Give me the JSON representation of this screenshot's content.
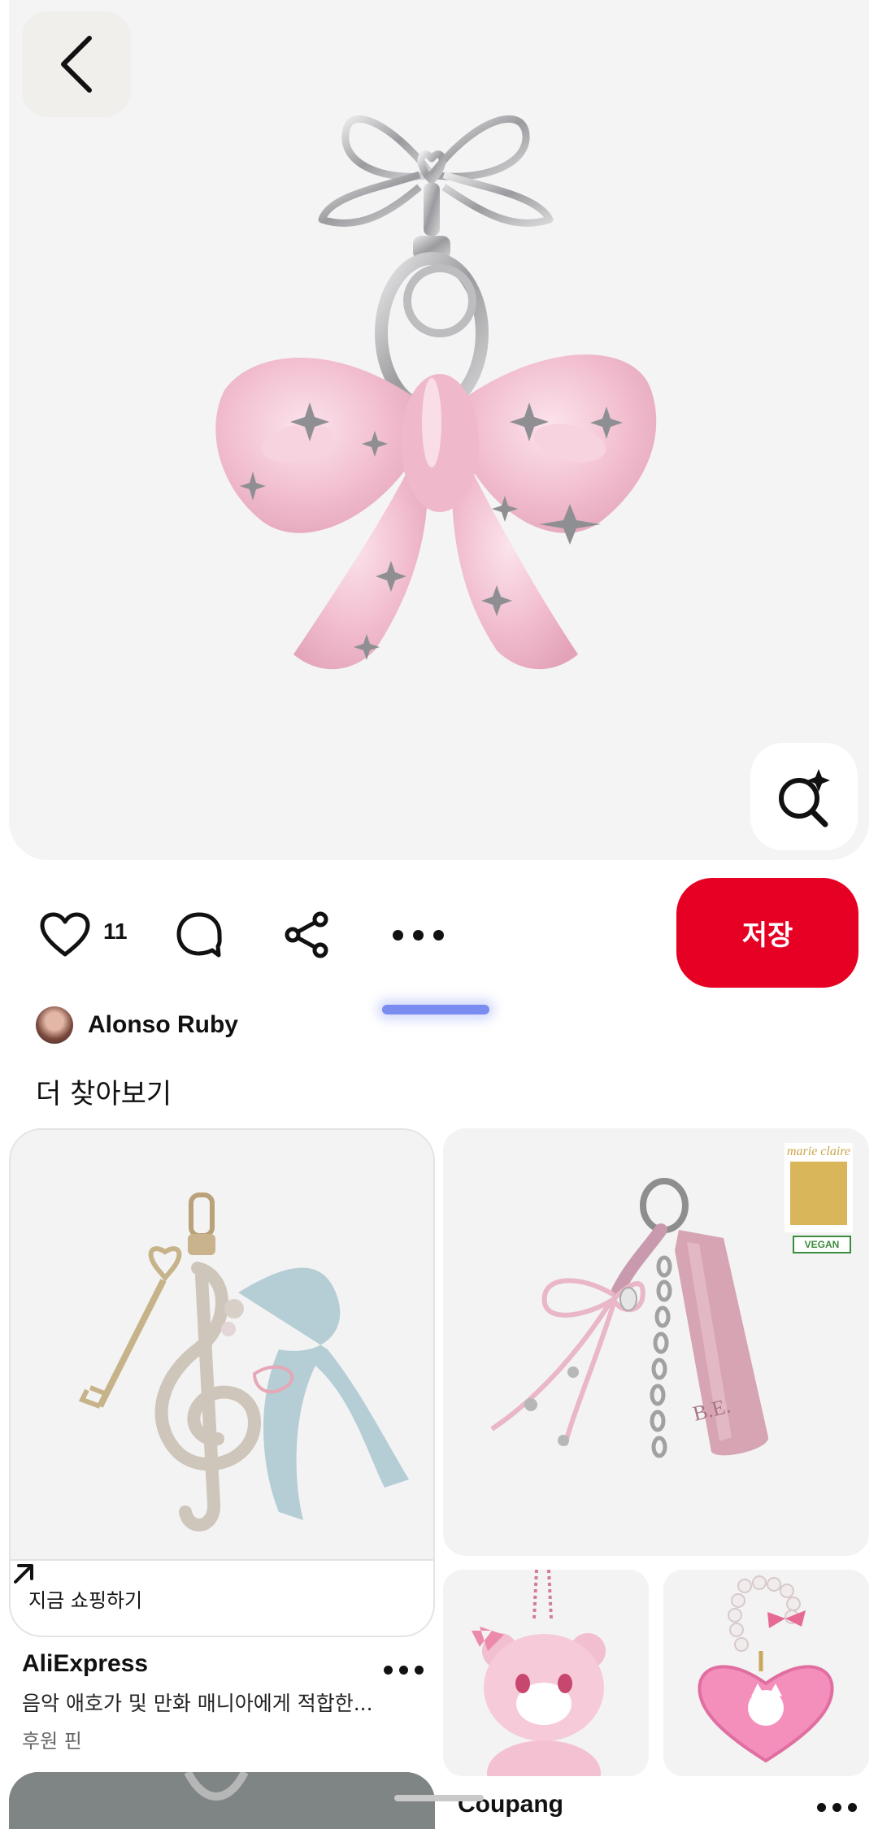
{
  "hero": {
    "back_icon": "chevron-left-icon",
    "visual_search_icon": "sparkle-search-icon"
  },
  "actions": {
    "like_icon": "heart-icon",
    "like_count": "11",
    "comment_icon": "comment-icon",
    "share_icon": "share-icon",
    "more_icon": "more-horizontal-icon",
    "save_label": "저장"
  },
  "creator": {
    "name": "Alonso Ruby"
  },
  "more_ideas": {
    "title": "더 찾아보기"
  },
  "pins": [
    {
      "shop_label": "지금 쇼핑하기",
      "source": "AliExpress",
      "description": "음악 애호가 및 만화 매니아에게 적합한...",
      "sponsored": "후원 핀"
    },
    {
      "badge_brand": "marie claire",
      "badge_vegan": "VEGAN"
    },
    {},
    {},
    {
      "source": "Coupang"
    }
  ],
  "colors": {
    "save_button": "#e60023",
    "hero_background": "#f4f4f4",
    "scroll_indicator": "#7a8cf0"
  }
}
